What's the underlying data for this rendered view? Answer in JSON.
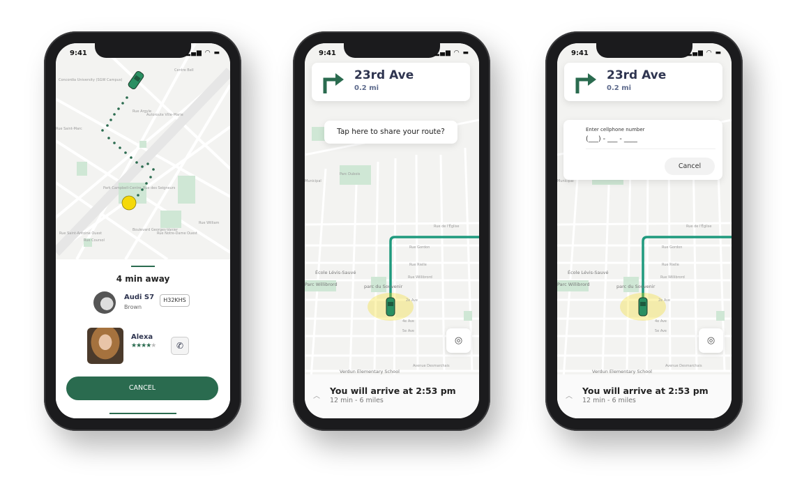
{
  "colors": {
    "brand": "#2a6b4f",
    "route": "#1f9a7e",
    "pin": "#f5d90a",
    "park": "#cfe7d5"
  },
  "status": {
    "time": "9:41",
    "icons": "signal-icon wifi-icon battery-icon"
  },
  "screen1": {
    "map_labels": [
      "Concordia University (SGW Campus)",
      "Autoroute Ville-Marie",
      "Rue Argyle",
      "Park Campbell-Centre",
      "Rue des Seigneurs",
      "Boulevard Georges-Vanier",
      "Rue Notre-Dame Ouest",
      "Rue Saint-Antoine Ouest",
      "Rue Coursol",
      "Rue William",
      "Rue Saint-Marc",
      "Centre Bell"
    ],
    "eta": "4 min away",
    "car_model": "Audi S7",
    "car_color": "Brown",
    "plate": "H32KHS",
    "driver_name": "Alexa",
    "rating": 4.5,
    "rating_max": 5,
    "cancel": "CANCEL"
  },
  "nav": {
    "street": "23rd Ave",
    "distance": "0.2 mi",
    "arrive": "You will arrive at 2:53 pm",
    "arrive_sub": "12 min - 6 miles"
  },
  "map2_labels": [
    "Parc Dubois",
    "Rue de l'Église",
    "Rue Gordon",
    "Rue Rielle",
    "École Lévis-Sauvé",
    "Rue Willibrord",
    "Parc Willibrord",
    "parc du Souvenir",
    "2e Ave",
    "4e Ave",
    "5e Ave",
    "Avenue Desmarchais",
    "Verdun Elementary School",
    "Rue Argyle",
    "Municipal"
  ],
  "screen2": {
    "tooltip": "Tap here to share your route?"
  },
  "screen3": {
    "dialog_label": "Enter cellphone number",
    "phone_placeholder": "(___) - ___ - ____",
    "cancel": "Cancel"
  }
}
